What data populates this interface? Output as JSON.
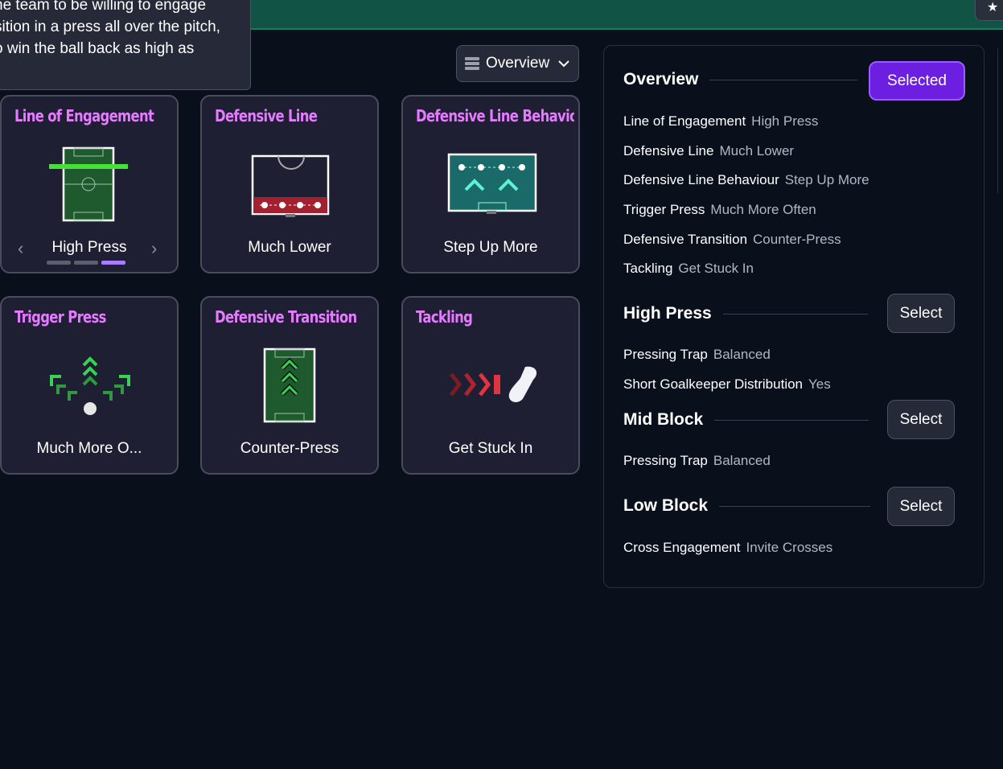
{
  "tooltip": {
    "text": "he team to be willing to engage\nsition in a press all over the pitch,\no win the ball back as high as"
  },
  "view_dropdown": {
    "label": "Overview"
  },
  "cards": [
    {
      "title": "Line of Engagement",
      "value": "High Press",
      "page": 3,
      "pages": 3
    },
    {
      "title": "Defensive Line",
      "value": "Much Lower"
    },
    {
      "title": "Defensive Line Behavio",
      "value": "Step Up More"
    },
    {
      "title": "Trigger Press",
      "value": "Much More O..."
    },
    {
      "title": "Defensive Transition",
      "value": "Counter-Press"
    },
    {
      "title": "Tackling",
      "value": "Get Stuck In"
    }
  ],
  "panel": {
    "overview": {
      "heading": "Overview",
      "button": "Selected",
      "rows": [
        {
          "k": "Line of Engagement",
          "v": "High Press"
        },
        {
          "k": "Defensive Line",
          "v": "Much Lower"
        },
        {
          "k": "Defensive Line Behaviour",
          "v": "Step Up More"
        },
        {
          "k": "Trigger Press",
          "v": "Much More Often"
        },
        {
          "k": "Defensive Transition",
          "v": "Counter-Press"
        },
        {
          "k": "Tackling",
          "v": "Get Stuck In"
        }
      ]
    },
    "high_press": {
      "heading": "High Press",
      "button": "Select",
      "rows": [
        {
          "k": "Pressing Trap",
          "v": "Balanced"
        },
        {
          "k": "Short Goalkeeper Distribution",
          "v": "Yes"
        }
      ]
    },
    "mid_block": {
      "heading": "Mid Block",
      "button": "Select",
      "rows": [
        {
          "k": "Pressing Trap",
          "v": "Balanced"
        }
      ]
    },
    "low_block": {
      "heading": "Low Block",
      "button": "Select",
      "rows": [
        {
          "k": "Cross Engagement",
          "v": "Invite Crosses"
        }
      ]
    }
  },
  "colors": {
    "accent_purple": "#6c1fe0",
    "title_pink": "#e57bff",
    "topbar_green": "#115345",
    "pitch_green": "#1f5a2e",
    "arrow_green": "#39d353"
  },
  "icons": {
    "star": "★",
    "prev": "‹",
    "next": "›",
    "chevron": "⌄"
  }
}
